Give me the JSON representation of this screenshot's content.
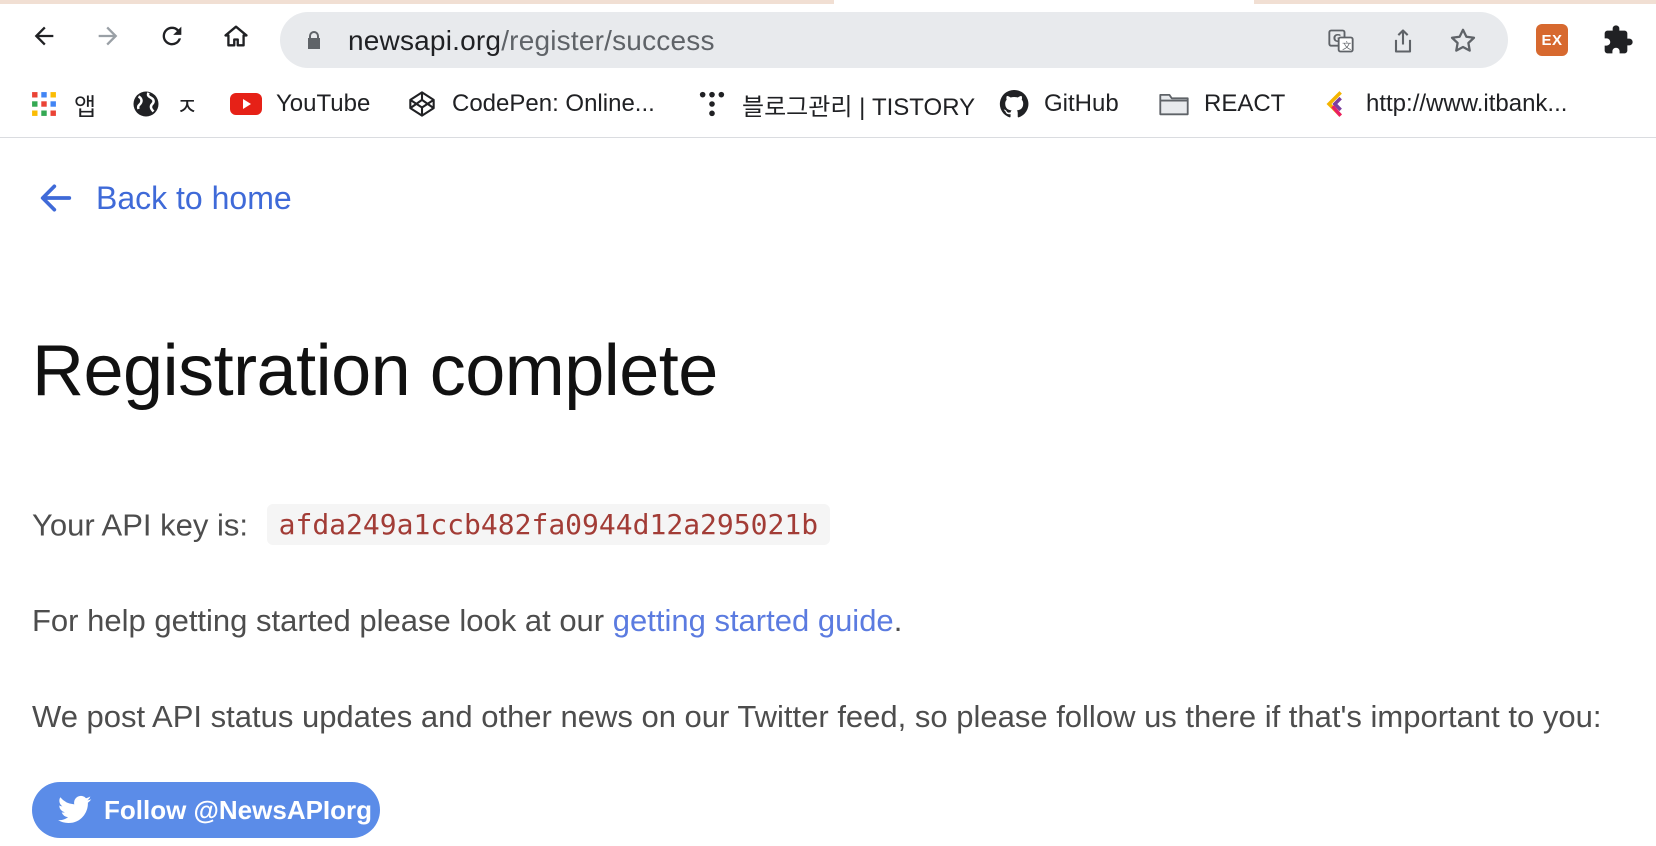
{
  "browser": {
    "url_host": "newsapi.org",
    "url_path": "/register/success",
    "extension_badge": "EX"
  },
  "bookmarks": [
    {
      "label": "앱",
      "icon": "apps-grid-icon"
    },
    {
      "label": "ㅈ",
      "icon": "globe-icon"
    },
    {
      "label": "YouTube",
      "icon": "youtube-icon"
    },
    {
      "label": "CodePen: Online...",
      "icon": "codepen-icon"
    },
    {
      "label": "블로그관리 | TISTORY",
      "icon": "tistory-icon"
    },
    {
      "label": "GitHub",
      "icon": "github-icon"
    },
    {
      "label": "REACT",
      "icon": "folder-icon"
    },
    {
      "label": "http://www.itbank...",
      "icon": "itbank-icon"
    }
  ],
  "page": {
    "back_link": "Back to home",
    "title": "Registration complete",
    "api_key_label": "Your API key is:",
    "api_key": "afda249a1ccb482fa0944d12a295021b",
    "help_prefix": "For help getting started please look at our",
    "help_link": "getting started guide",
    "help_suffix": ".",
    "twitter_text": "We post API status updates and other news on our Twitter feed, so please follow us there if that's important to you:",
    "follow_button": "Follow @NewsAPIorg"
  },
  "colors": {
    "link": "#3f6ad8",
    "follow_button": "#5b8ce8",
    "api_key_text": "#a23c36"
  }
}
